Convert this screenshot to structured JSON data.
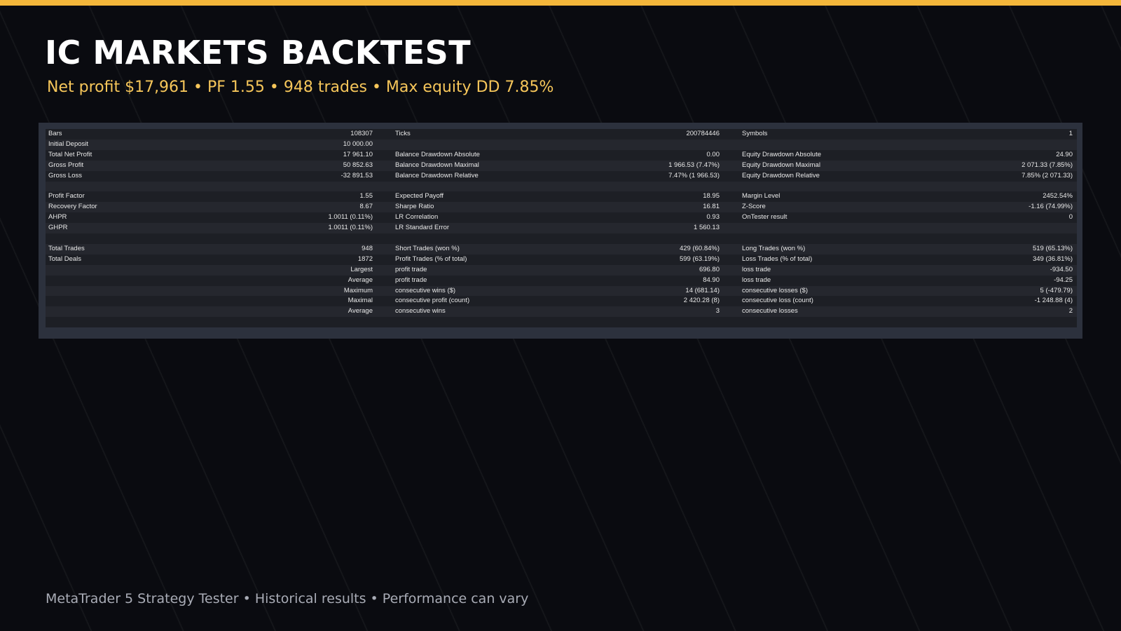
{
  "header": {
    "title": "IC MARKETS BACKTEST",
    "subtitle": "Net profit $17,961 • PF 1.55 • 948 trades • Max equity DD 7.85%"
  },
  "report": {
    "rows": [
      [
        "Bars",
        "108307",
        "Ticks",
        "200784446",
        "Symbols",
        "1"
      ],
      [
        "Initial Deposit",
        "10 000.00",
        "",
        "",
        "",
        ""
      ],
      [
        "Total Net Profit",
        "17 961.10",
        "Balance Drawdown Absolute",
        "0.00",
        "Equity Drawdown Absolute",
        "24.90"
      ],
      [
        "Gross Profit",
        "50 852.63",
        "Balance Drawdown Maximal",
        "1 966.53 (7.47%)",
        "Equity Drawdown Maximal",
        "2 071.33 (7.85%)"
      ],
      [
        "Gross Loss",
        "-32 891.53",
        "Balance Drawdown Relative",
        "7.47% (1 966.53)",
        "Equity Drawdown Relative",
        "7.85% (2 071.33)"
      ],
      [
        "",
        "",
        "",
        "",
        "",
        ""
      ],
      [
        "Profit Factor",
        "1.55",
        "Expected Payoff",
        "18.95",
        "Margin Level",
        "2452.54%"
      ],
      [
        "Recovery Factor",
        "8.67",
        "Sharpe Ratio",
        "16.81",
        "Z-Score",
        "-1.16 (74.99%)"
      ],
      [
        "AHPR",
        "1.0011 (0.11%)",
        "LR Correlation",
        "0.93",
        "OnTester result",
        "0"
      ],
      [
        "GHPR",
        "1.0011 (0.11%)",
        "LR Standard Error",
        "1 560.13",
        "",
        ""
      ],
      [
        "",
        "",
        "",
        "",
        "",
        ""
      ],
      [
        "Total Trades",
        "948",
        "Short Trades (won %)",
        "429 (60.84%)",
        "Long Trades (won %)",
        "519 (65.13%)"
      ],
      [
        "Total Deals",
        "1872",
        "Profit Trades (% of total)",
        "599 (63.19%)",
        "Loss Trades (% of total)",
        "349 (36.81%)"
      ],
      [
        "",
        "Largest",
        "profit trade",
        "696.80",
        "loss trade",
        "-934.50"
      ],
      [
        "",
        "Average",
        "profit trade",
        "84.90",
        "loss trade",
        "-94.25"
      ],
      [
        "",
        "Maximum",
        "consecutive wins ($)",
        "14 (681.14)",
        "consecutive losses ($)",
        "5 (-479.79)"
      ],
      [
        "",
        "Maximal",
        "consecutive profit (count)",
        "2 420.28 (8)",
        "consecutive loss (count)",
        "-1 248.88 (4)"
      ],
      [
        "",
        "Average",
        "consecutive wins",
        "3",
        "consecutive losses",
        "2"
      ],
      [
        "",
        "",
        "",
        "",
        "",
        ""
      ]
    ]
  },
  "footer": {
    "text": "MetaTrader 5 Strategy Tester • Historical results • Performance can vary"
  }
}
